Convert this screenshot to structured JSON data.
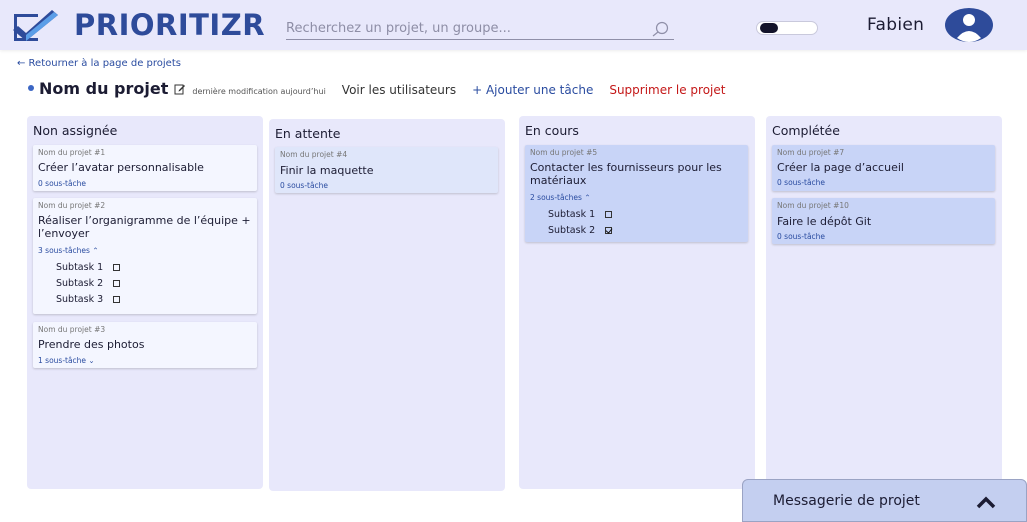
{
  "header": {
    "logo_text": "PRIORITIZR",
    "search_placeholder": "Recherchez un projet, un groupe...",
    "username": "Fabien",
    "icons": {
      "search": "search-icon",
      "avatar": "user-avatar-icon",
      "theme": "theme-toggle"
    },
    "colors": {
      "header_bg": "#e8e8fb",
      "logo": "#2e4b9a"
    }
  },
  "subheader": {
    "back_link": "← Retourner à la page de projets",
    "project_title": "Nom du projet",
    "last_modified": "dernière modification aujourd’hui",
    "actions": {
      "users": "Voir les utilisateurs",
      "add_task": "+ Ajouter une tâche",
      "delete": "Supprimer le projet"
    }
  },
  "columns": [
    {
      "title": "Non assignée",
      "cards": [
        {
          "project": "Nom du projet #1",
          "task": "Créer l’avatar personnalisable",
          "subtasks_label": "0 sous-tâche"
        },
        {
          "project": "Nom du projet #2",
          "task": "Réaliser l’organigramme de l’équipe + l’envoyer",
          "subtasks_label": "3 sous-tâches ⌃",
          "subtasks": [
            {
              "label": "Subtask 1",
              "checked": false
            },
            {
              "label": "Subtask 2",
              "checked": false
            },
            {
              "label": "Subtask 3",
              "checked": false
            }
          ]
        },
        {
          "project": "Nom du projet #3",
          "task": "Prendre des photos",
          "subtasks_label": "1 sous-tâche ⌄"
        }
      ]
    },
    {
      "title": "En attente",
      "cards": [
        {
          "project": "Nom du projet #4",
          "task": "Finir la maquette",
          "subtasks_label": "0 sous-tâche"
        }
      ]
    },
    {
      "title": "En cours",
      "cards": [
        {
          "project": "Nom du projet #5",
          "task": "Contacter les fournisseurs pour les matériaux",
          "subtasks_label": "2 sous-tâches ⌃",
          "subtasks": [
            {
              "label": "Subtask 1",
              "checked": false
            },
            {
              "label": "Subtask 2",
              "checked": true
            }
          ]
        }
      ]
    },
    {
      "title": "Complétée",
      "cards": [
        {
          "project": "Nom du projet #7",
          "task": "Créer la page d’accueil",
          "subtasks_label": "0 sous-tâche"
        },
        {
          "project": "Nom du projet #10",
          "task": "Faire le dépôt Git",
          "subtasks_label": "0 sous-tâche"
        }
      ]
    }
  ],
  "chat": {
    "label": "Messagerie de projet",
    "icon": "chevron-up-icon"
  }
}
